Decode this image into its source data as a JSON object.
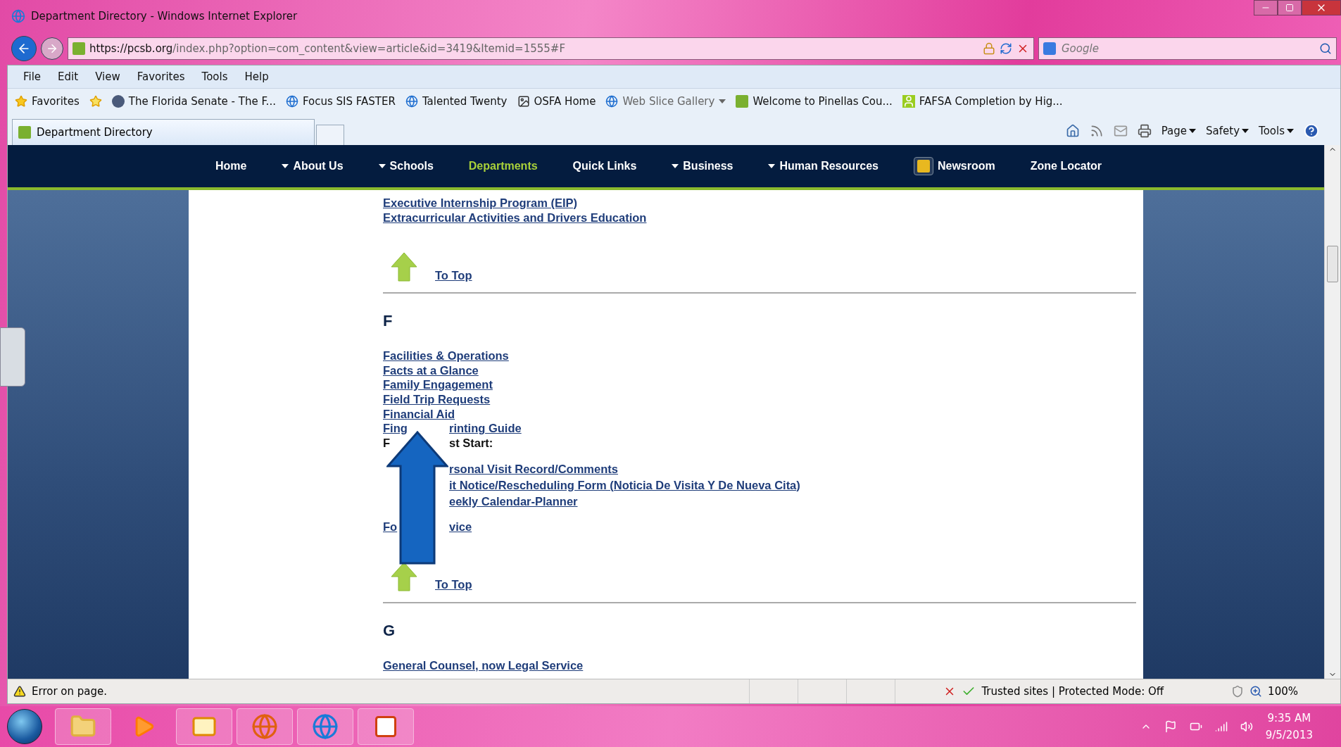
{
  "window": {
    "title": "Department Directory - Windows Internet Explorer"
  },
  "address_bar": {
    "url_host": "https://pcsb.org",
    "url_path": "/index.php?option=com_content&view=article&id=3419&Itemid=1555#F"
  },
  "search": {
    "placeholder": "Google"
  },
  "menu": [
    "File",
    "Edit",
    "View",
    "Favorites",
    "Tools",
    "Help"
  ],
  "favorites_bar": {
    "label": "Favorites",
    "items": [
      {
        "label": "The Florida Senate - The F...",
        "kind": "seal"
      },
      {
        "label": "Focus SIS FASTER",
        "kind": "ie"
      },
      {
        "label": "Talented Twenty",
        "kind": "ie"
      },
      {
        "label": "OSFA Home",
        "kind": "osfa"
      },
      {
        "label": "Web Slice Gallery",
        "kind": "slice"
      },
      {
        "label": "Welcome to Pinellas Cou...",
        "kind": "pcsb"
      },
      {
        "label": "FAFSA Completion by Hig...",
        "kind": "person"
      }
    ]
  },
  "tab": {
    "label": "Department Directory"
  },
  "command_bar": [
    "Page",
    "Safety",
    "Tools"
  ],
  "site_nav": [
    {
      "label": "Home",
      "dropdown": false,
      "selected": false
    },
    {
      "label": "About Us",
      "dropdown": true,
      "selected": false
    },
    {
      "label": "Schools",
      "dropdown": true,
      "selected": false
    },
    {
      "label": "Departments",
      "dropdown": false,
      "selected": true
    },
    {
      "label": "Quick Links",
      "dropdown": false,
      "selected": false
    },
    {
      "label": "Business",
      "dropdown": true,
      "selected": false
    },
    {
      "label": "Human Resources",
      "dropdown": true,
      "selected": false
    },
    {
      "label": "Newsroom",
      "dropdown": false,
      "selected": false,
      "kind": "icon"
    },
    {
      "label": "Zone Locator",
      "dropdown": false,
      "selected": false
    }
  ],
  "sections": [
    {
      "entries": [
        {
          "kind": "link",
          "text": "Executive Internship Program (EIP)"
        },
        {
          "kind": "link",
          "text": "Extracurricular Activities and Drivers Education"
        }
      ],
      "to_top": "To Top"
    },
    {
      "letter": "F",
      "entries": [
        {
          "kind": "link",
          "text": "Facilities & Operations"
        },
        {
          "kind": "link",
          "text": "Facts at a Glance"
        },
        {
          "kind": "link",
          "text": "Family Engagement"
        },
        {
          "kind": "link",
          "text": "Field Trip Requests"
        },
        {
          "kind": "link",
          "text": "Financial Aid"
        },
        {
          "kind": "link",
          "text": "Fing",
          "text_after": "rinting Guide"
        },
        {
          "kind": "label",
          "text": "F",
          "text_after": "st Start:"
        },
        {
          "kind": "sublink",
          "text_after": "rsonal Visit Record/Comments"
        },
        {
          "kind": "sublink",
          "text_after": "it Notice/Rescheduling Form (Noticia De Visita Y De Nueva Cita)"
        },
        {
          "kind": "sublink",
          "text_after": "eekly Calendar-Planner"
        },
        {
          "kind": "gap"
        },
        {
          "kind": "link",
          "text": "Fo",
          "text_after": "vice"
        }
      ],
      "to_top": "To Top"
    },
    {
      "letter": "G",
      "entries": [
        {
          "kind": "link",
          "text": "General Counsel, now Legal Service"
        }
      ]
    }
  ],
  "status_bar": {
    "message": "Error on page.",
    "zone": "Trusted sites | Protected Mode: Off",
    "zoom": "100%"
  },
  "taskbar": {
    "time": "9:35 AM",
    "date": "9/5/2013"
  }
}
